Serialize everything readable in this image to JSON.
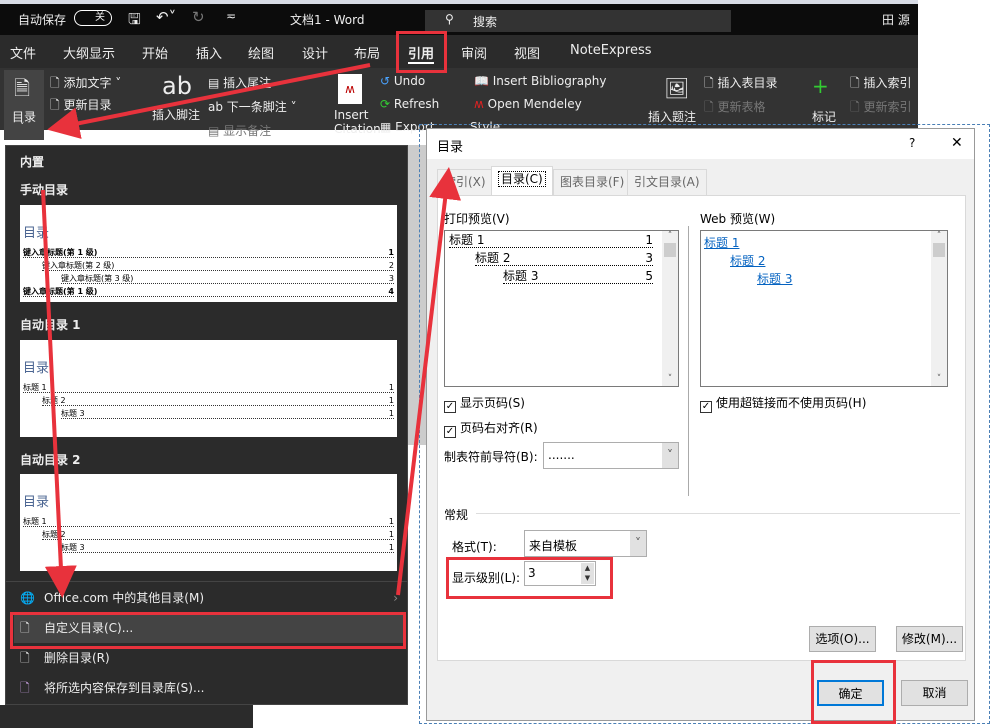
{
  "titlebar": {
    "autosave": "自动保存",
    "toggle": "关",
    "title": "文档1  -  Word",
    "search": "搜索",
    "user": "田 源"
  },
  "tabs": [
    "文件",
    "大纲显示",
    "开始",
    "插入",
    "绘图",
    "设计",
    "布局",
    "引用",
    "审阅",
    "视图",
    "NoteExpress"
  ],
  "active_tab": "引用",
  "ribbon": {
    "toc": "目录",
    "add_text": "添加文字",
    "update_toc": "更新目录",
    "insert_footnote": "插入脚注",
    "insert_endnote": "插入尾注",
    "next_footnote": "下一条脚注",
    "show_notes": "显示备注",
    "insert_citation": "Insert Citation",
    "undo": "Undo",
    "refresh": "Refresh",
    "export": "Export",
    "style": "Style",
    "insert_bibliography": "Insert Bibliography",
    "open_mendeley": "Open Mendeley",
    "insert_caption": "插入题注",
    "insert_table_of_figures": "插入表目录",
    "update_table": "更新表格",
    "mark_entry": "标记",
    "insert_index": "插入索引",
    "update_index": "更新索引"
  },
  "panel": {
    "builtin": "内置",
    "manual": {
      "label": "手动目录",
      "heading": "目录",
      "lines": [
        {
          "t": "键入章标题(第 1 级)",
          "p": "1"
        },
        {
          "t": "键入章标题(第 2 级)",
          "p": "2"
        },
        {
          "t": "键入章标题(第 3 级)",
          "p": "3"
        },
        {
          "t": "键入章标题(第 1 级)",
          "p": "4"
        }
      ]
    },
    "auto1": {
      "label": "自动目录 1",
      "heading": "目录",
      "lines": [
        {
          "t": "标题 1",
          "p": "1"
        },
        {
          "t": "标题 2",
          "p": "1"
        },
        {
          "t": "标题 3",
          "p": "1"
        }
      ]
    },
    "auto2": {
      "label": "自动目录 2",
      "heading": "目录",
      "lines": [
        {
          "t": "标题 1",
          "p": "1"
        },
        {
          "t": "标题 2",
          "p": "1"
        },
        {
          "t": "标题 3",
          "p": "1"
        }
      ]
    },
    "menu": [
      "Office.com 中的其他目录(M)",
      "自定义目录(C)...",
      "删除目录(R)",
      "将所选内容保存到目录库(S)..."
    ]
  },
  "dialog": {
    "title": "目录",
    "help": "?",
    "close": "✕",
    "tabs": [
      "索引(X)",
      "目录(C)",
      "图表目录(F)",
      "引文目录(A)"
    ],
    "active_tab": "目录(C)",
    "print_preview_label": "打印预览(V)",
    "print_preview": [
      {
        "t": "标题 1",
        "p": "1"
      },
      {
        "t": "标题 2",
        "p": "3"
      },
      {
        "t": "标题 3",
        "p": "5"
      }
    ],
    "web_preview_label": "Web 预览(W)",
    "web_preview": [
      "标题 1",
      "标题 2",
      "标题 3"
    ],
    "show_page_numbers": {
      "label": "显示页码(S)",
      "checked": true
    },
    "right_align": {
      "label": "页码右对齐(R)",
      "checked": true
    },
    "use_hyperlinks": {
      "label": "使用超链接而不使用页码(H)",
      "checked": true
    },
    "tab_leader_label": "制表符前导符(B):",
    "tab_leader": ".......",
    "general": "常规",
    "format_label": "格式(T):",
    "format": "来自模板",
    "levels_label": "显示级别(L):",
    "levels": "3",
    "options": "选项(O)...",
    "modify": "修改(M)...",
    "ok": "确定",
    "cancel": "取消"
  },
  "colors": {
    "annotation": "#e8323c",
    "accent": "#0078d7"
  }
}
